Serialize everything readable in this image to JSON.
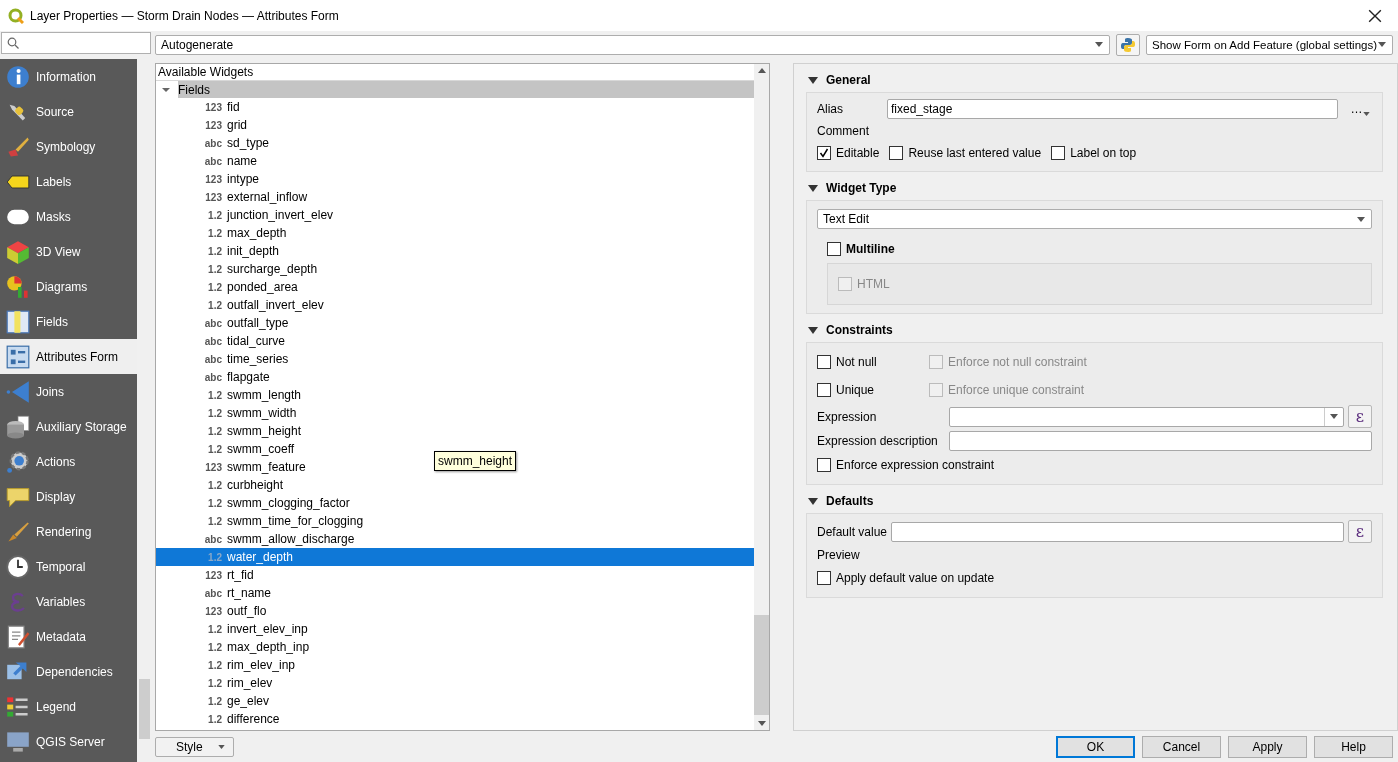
{
  "window": {
    "title": "Layer Properties — Storm Drain Nodes — Attributes Form"
  },
  "sidebar": {
    "items": [
      {
        "label": "Information",
        "selected": false
      },
      {
        "label": "Source",
        "selected": false
      },
      {
        "label": "Symbology",
        "selected": false
      },
      {
        "label": "Labels",
        "selected": false
      },
      {
        "label": "Masks",
        "selected": false
      },
      {
        "label": "3D View",
        "selected": false
      },
      {
        "label": "Diagrams",
        "selected": false
      },
      {
        "label": "Fields",
        "selected": false
      },
      {
        "label": "Attributes Form",
        "selected": true
      },
      {
        "label": "Joins",
        "selected": false
      },
      {
        "label": "Auxiliary Storage",
        "selected": false
      },
      {
        "label": "Actions",
        "selected": false
      },
      {
        "label": "Display",
        "selected": false
      },
      {
        "label": "Rendering",
        "selected": false
      },
      {
        "label": "Temporal",
        "selected": false
      },
      {
        "label": "Variables",
        "selected": false
      },
      {
        "label": "Metadata",
        "selected": false
      },
      {
        "label": "Dependencies",
        "selected": false
      },
      {
        "label": "Legend",
        "selected": false
      },
      {
        "label": "QGIS Server",
        "selected": false
      }
    ]
  },
  "toolbar": {
    "layout_mode": "Autogenerate",
    "add_feature_mode": "Show Form on Add Feature (global settings)"
  },
  "widgets": {
    "header": "Available Widgets",
    "group": {
      "label": "Fields",
      "expanded": true,
      "children": [
        {
          "type": "123",
          "name": "fid",
          "selected": false
        },
        {
          "type": "123",
          "name": "grid",
          "selected": false
        },
        {
          "type": "abc",
          "name": "sd_type",
          "selected": false
        },
        {
          "type": "abc",
          "name": "name",
          "selected": false
        },
        {
          "type": "123",
          "name": "intype",
          "selected": false
        },
        {
          "type": "123",
          "name": "external_inflow",
          "selected": false
        },
        {
          "type": "1.2",
          "name": "junction_invert_elev",
          "selected": false
        },
        {
          "type": "1.2",
          "name": "max_depth",
          "selected": false
        },
        {
          "type": "1.2",
          "name": "init_depth",
          "selected": false
        },
        {
          "type": "1.2",
          "name": "surcharge_depth",
          "selected": false
        },
        {
          "type": "1.2",
          "name": "ponded_area",
          "selected": false
        },
        {
          "type": "1.2",
          "name": "outfall_invert_elev",
          "selected": false
        },
        {
          "type": "abc",
          "name": "outfall_type",
          "selected": false
        },
        {
          "type": "abc",
          "name": "tidal_curve",
          "selected": false
        },
        {
          "type": "abc",
          "name": "time_series",
          "selected": false
        },
        {
          "type": "abc",
          "name": "flapgate",
          "selected": false
        },
        {
          "type": "1.2",
          "name": "swmm_length",
          "selected": false
        },
        {
          "type": "1.2",
          "name": "swmm_width",
          "selected": false
        },
        {
          "type": "1.2",
          "name": "swmm_height",
          "selected": false
        },
        {
          "type": "1.2",
          "name": "swmm_coeff",
          "selected": false
        },
        {
          "type": "123",
          "name": "swmm_feature",
          "selected": false
        },
        {
          "type": "1.2",
          "name": "curbheight",
          "selected": false
        },
        {
          "type": "1.2",
          "name": "swmm_clogging_factor",
          "selected": false
        },
        {
          "type": "1.2",
          "name": "swmm_time_for_clogging",
          "selected": false
        },
        {
          "type": "abc",
          "name": "swmm_allow_discharge",
          "selected": false
        },
        {
          "type": "1.2",
          "name": "water_depth",
          "selected": true
        },
        {
          "type": "123",
          "name": "rt_fid",
          "selected": false
        },
        {
          "type": "abc",
          "name": "rt_name",
          "selected": false
        },
        {
          "type": "123",
          "name": "outf_flo",
          "selected": false
        },
        {
          "type": "1.2",
          "name": "invert_elev_inp",
          "selected": false
        },
        {
          "type": "1.2",
          "name": "max_depth_inp",
          "selected": false
        },
        {
          "type": "1.2",
          "name": "rim_elev_inp",
          "selected": false
        },
        {
          "type": "1.2",
          "name": "rim_elev",
          "selected": false
        },
        {
          "type": "1.2",
          "name": "ge_elev",
          "selected": false
        },
        {
          "type": "1.2",
          "name": "difference",
          "selected": false
        }
      ]
    },
    "tooltip": "swmm_height"
  },
  "general": {
    "title": "General",
    "expanded": true,
    "alias_label": "Alias",
    "alias": "fixed_stage",
    "alias_button": "…",
    "comment_label": "Comment",
    "options": [
      {
        "label": "Editable",
        "checked": true
      },
      {
        "label": "Reuse last entered value",
        "checked": false
      },
      {
        "label": "Label on top",
        "checked": false
      }
    ]
  },
  "widget_type": {
    "title": "Widget Type",
    "expanded": true,
    "value": "Text Edit",
    "multiline": {
      "label": "Multiline",
      "checked": false
    },
    "html": {
      "label": "HTML",
      "checked": false,
      "disabled": true
    }
  },
  "constraints": {
    "title": "Constraints",
    "expanded": true,
    "rows": [
      {
        "label": "Not null",
        "checked": false,
        "enforce": {
          "label": "Enforce not null constraint",
          "checked": false,
          "disabled": true
        }
      },
      {
        "label": "Unique",
        "checked": false,
        "enforce": {
          "label": "Enforce unique constraint",
          "checked": false,
          "disabled": true
        }
      }
    ],
    "expression_label": "Expression",
    "expression_button": "ε",
    "description_label": "Expression description",
    "enforce_expression": {
      "label": "Enforce expression constraint",
      "checked": false
    }
  },
  "defaults": {
    "title": "Defaults",
    "expanded": true,
    "default_value_label": "Default value",
    "expression_button": "ε",
    "preview_label": "Preview",
    "apply_on_update": {
      "label": "Apply default value on update",
      "checked": false
    }
  },
  "footer": {
    "style": "Style",
    "buttons": [
      {
        "label": "OK",
        "default": true
      },
      {
        "label": "Cancel",
        "default": false
      },
      {
        "label": "Apply",
        "default": false
      },
      {
        "label": "Help",
        "default": false
      }
    ]
  }
}
